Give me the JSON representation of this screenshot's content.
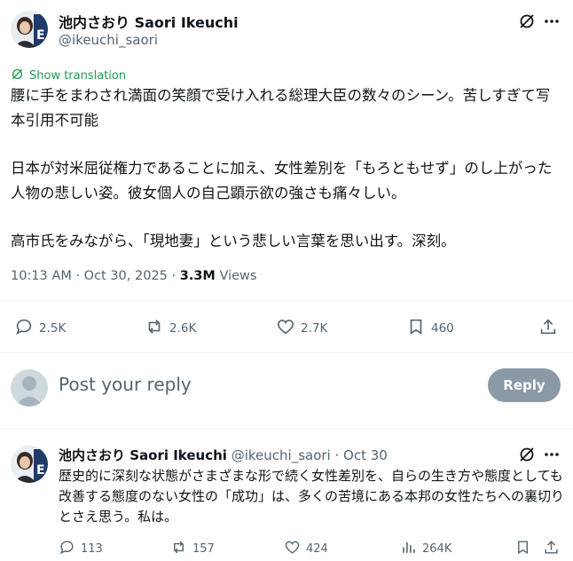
{
  "tweet": {
    "author_name": "池内さおり Saori Ikeuchi",
    "handle": "@ikeuchi_saori",
    "show_translation": "Show translation",
    "paragraphs": [
      "腰に手をまわされ満面の笑顔で受け入れる総理大臣の数々のシーン。苦しすぎて写本引用不可能",
      "日本が対米屈従権力であることに加え、女性差別を「もろともせず」のし上がった人物の悲しい姿。彼女個人の自己顕示欲の強さも痛々しい。",
      "高市氏をみながら、「現地妻」という悲しい言葉を思い出す。深刻。"
    ],
    "time": "10:13 AM",
    "date": "Oct 30, 2025",
    "views_count": "3.3M",
    "views_label": "Views",
    "stats": {
      "replies": "2.5K",
      "reposts": "2.6K",
      "likes": "2.7K",
      "bookmarks": "460"
    }
  },
  "reply_box": {
    "placeholder": "Post your reply",
    "button": "Reply"
  },
  "reply_tweet": {
    "author_name": "池内さおり Saori Ikeuchi",
    "handle": "@ikeuchi_saori",
    "date": "Oct 30",
    "text": "歴史的に深刻な状態がさまざまな形で続く女性差別を、自らの生き方や態度としても改善する態度のない女性の「成功」は、多くの苦境にある本邦の女性たちへの裏切りとさえ思う。私は。",
    "stats": {
      "replies": "113",
      "reposts": "157",
      "likes": "424",
      "views": "264K"
    }
  },
  "colors": {
    "text": "#0f1419",
    "muted": "#536471",
    "translate_green": "#1d9b50",
    "reply_button": "#8b98a5"
  }
}
